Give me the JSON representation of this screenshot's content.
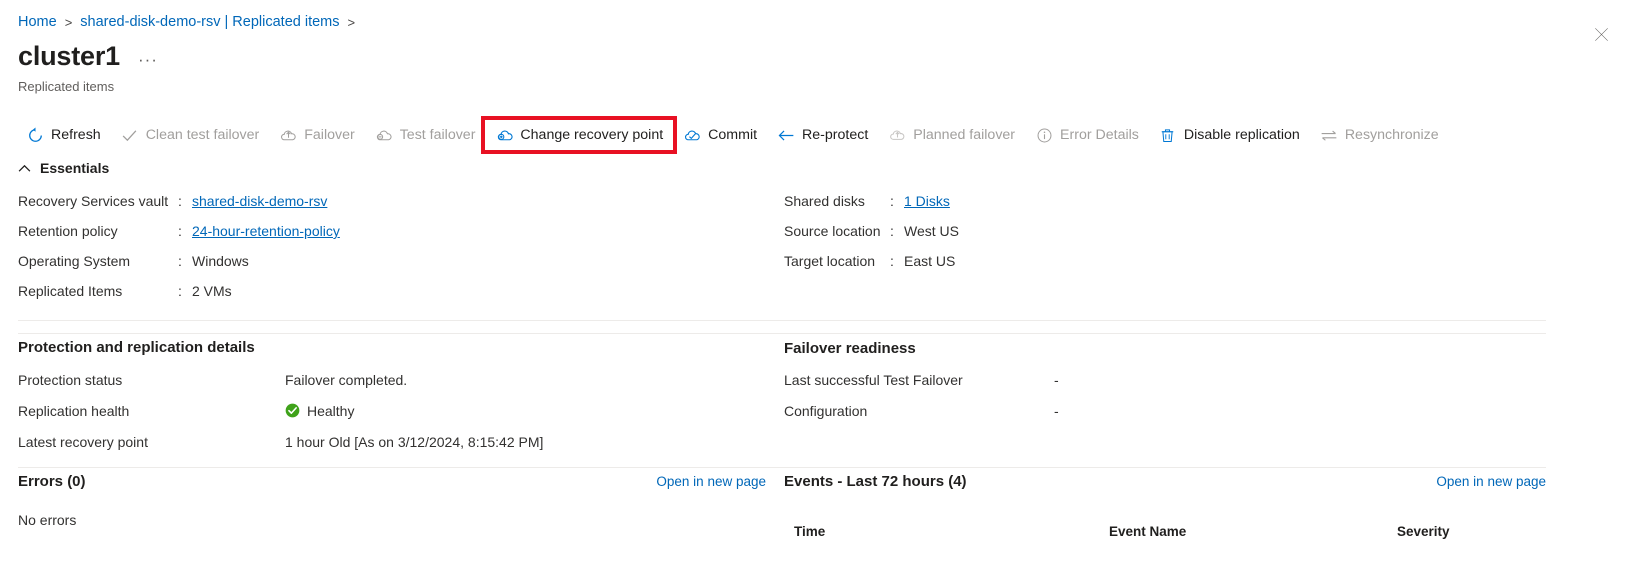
{
  "breadcrumb": {
    "items": [
      {
        "label": "Home",
        "type": "link"
      },
      {
        "label": "shared-disk-demo-rsv | Replicated items",
        "type": "link"
      }
    ],
    "separator": ">"
  },
  "header": {
    "title": "cluster1",
    "ellipsis": "···",
    "subtitle": "Replicated items",
    "close_label": "Close"
  },
  "commandbar": {
    "items": [
      {
        "label": "Refresh",
        "icon": "refresh-icon",
        "disabled": false,
        "highlighted": false
      },
      {
        "label": "Clean test failover",
        "icon": "checkmark-icon",
        "disabled": true,
        "highlighted": false
      },
      {
        "label": "Failover",
        "icon": "failover-cloud-icon",
        "disabled": true,
        "highlighted": false
      },
      {
        "label": "Test failover",
        "icon": "test-failover-icon",
        "disabled": true,
        "highlighted": false
      },
      {
        "label": "Change recovery point",
        "icon": "change-recovery-point-icon",
        "disabled": false,
        "highlighted": true
      },
      {
        "label": "Commit",
        "icon": "commit-icon",
        "disabled": false,
        "highlighted": false
      },
      {
        "label": "Re-protect",
        "icon": "arrow-left-icon",
        "disabled": false,
        "highlighted": false
      },
      {
        "label": "Planned failover",
        "icon": "planned-failover-icon",
        "disabled": true,
        "highlighted": false
      },
      {
        "label": "Error Details",
        "icon": "info-icon",
        "disabled": true,
        "highlighted": false
      },
      {
        "label": "Disable replication",
        "icon": "trash-icon",
        "disabled": false,
        "highlighted": false
      },
      {
        "label": "Resynchronize",
        "icon": "resynchronize-icon",
        "disabled": true,
        "highlighted": false
      }
    ],
    "highlight_color": "#e81123"
  },
  "essentials": {
    "toggle_label": "Essentials",
    "toggle_icon": "chevron-up-icon",
    "left": [
      {
        "key": "Recovery Services vault",
        "colon": ":",
        "value": "shared-disk-demo-rsv",
        "is_link": true
      },
      {
        "key": "Retention policy",
        "colon": ":",
        "value": "24-hour-retention-policy",
        "is_link": true
      },
      {
        "key": "Operating System",
        "colon": ":",
        "value": "Windows",
        "is_link": false
      },
      {
        "key": "Replicated Items",
        "colon": ":",
        "value": "2 VMs",
        "is_link": false
      }
    ],
    "right": [
      {
        "key": "Shared disks",
        "colon": ":",
        "value": "1 Disks",
        "is_link": true
      },
      {
        "key": "Source location",
        "colon": ":",
        "value": "West US",
        "is_link": false
      },
      {
        "key": "Target location",
        "colon": ":",
        "value": "East US",
        "is_link": false
      }
    ]
  },
  "protection_details": {
    "heading": "Protection and replication details",
    "rows": [
      {
        "key": "Protection status",
        "value": "Failover completed.",
        "status_icon": ""
      },
      {
        "key": "Replication health",
        "value": "Healthy",
        "status_icon": "healthy-check-icon"
      },
      {
        "key": "Latest recovery point",
        "value": "1 hour Old [As on 3/12/2024, 8:15:42 PM]",
        "status_icon": ""
      }
    ],
    "healthy_color": "#3fa21a"
  },
  "failover_readiness": {
    "heading": "Failover readiness",
    "rows": [
      {
        "key": "Last successful Test Failover",
        "value": "-"
      },
      {
        "key": "Configuration",
        "value": "-"
      }
    ]
  },
  "errors_panel": {
    "title": "Errors (0)",
    "open_link": "Open in new page",
    "empty_text": "No errors"
  },
  "events_panel": {
    "title": "Events - Last 72 hours (4)",
    "open_link": "Open in new page",
    "columns": [
      "Time",
      "Event Name",
      "Severity"
    ]
  },
  "colors": {
    "link": "#0067b8",
    "text": "#323130",
    "muted": "#605e5c",
    "disabled": "#a19f9d",
    "divider": "#edebe9"
  }
}
